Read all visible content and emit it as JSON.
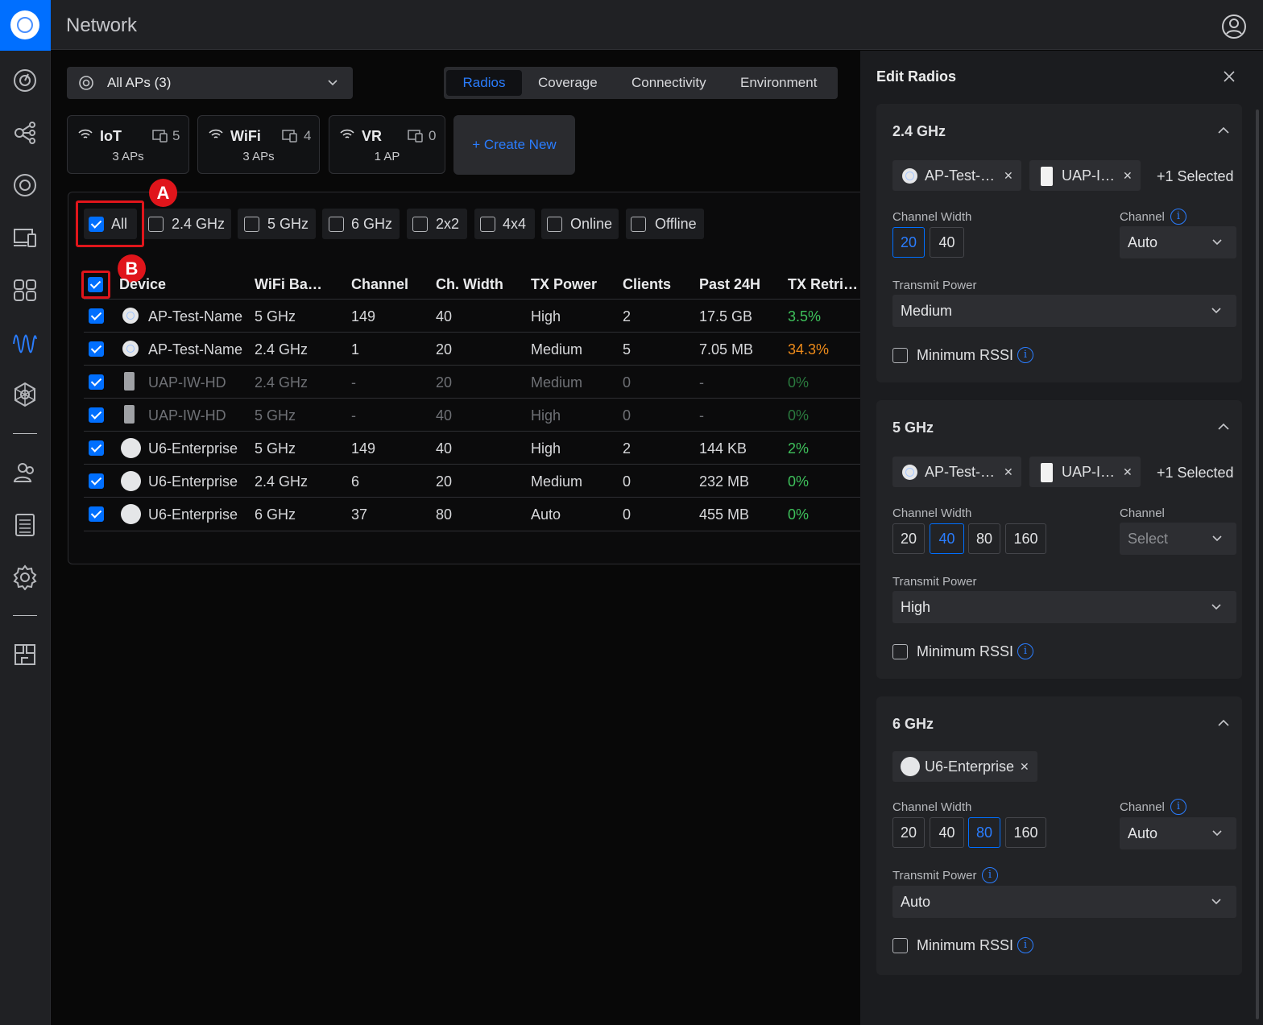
{
  "app": {
    "title": "Network"
  },
  "sidebar": {
    "items": [
      "dashboard",
      "topology",
      "devices",
      "clients-devices",
      "ports",
      "wifi-radios",
      "network-mesh",
      "users",
      "logs",
      "settings",
      "innerspace"
    ]
  },
  "toolbar": {
    "ap_select": "All APs (3)",
    "tabs": [
      {
        "label": "Radios",
        "active": true
      },
      {
        "label": "Coverage"
      },
      {
        "label": "Connectivity"
      },
      {
        "label": "Environment"
      }
    ]
  },
  "groups": [
    {
      "name": "IoT",
      "count": "5",
      "sub": "3 APs"
    },
    {
      "name": "WiFi",
      "count": "4",
      "sub": "3 APs"
    },
    {
      "name": "VR",
      "count": "0",
      "sub": "1 AP"
    }
  ],
  "create_new": "+ Create New",
  "filters": [
    {
      "label": "All",
      "checked": true
    },
    {
      "label": "2.4 GHz",
      "checked": false
    },
    {
      "label": "5 GHz",
      "checked": false
    },
    {
      "label": "6 GHz",
      "checked": false
    },
    {
      "label": "2x2",
      "checked": false
    },
    {
      "label": "4x4",
      "checked": false
    },
    {
      "label": "Online",
      "checked": false
    },
    {
      "label": "Offline",
      "checked": false
    }
  ],
  "annotations": {
    "a": "A",
    "b": "B"
  },
  "table": {
    "headers": [
      "Device",
      "WiFi Ba…",
      "Channel",
      "Ch. Width",
      "TX Power",
      "Clients",
      "Past 24H",
      "TX Retri…"
    ],
    "rows": [
      {
        "icon": "ring",
        "device": "AP-Test-Name",
        "band": "5 GHz",
        "channel": "149",
        "width": "40",
        "tx": "High",
        "clients": "2",
        "past": "17.5 GB",
        "retry": "3.5%",
        "retry_color": "green",
        "dim": false
      },
      {
        "icon": "ring",
        "device": "AP-Test-Name",
        "band": "2.4 GHz",
        "channel": "1",
        "width": "20",
        "tx": "Medium",
        "clients": "5",
        "past": "7.05 MB",
        "retry": "34.3%",
        "retry_color": "orange",
        "dim": false
      },
      {
        "icon": "box",
        "device": "UAP-IW-HD",
        "band": "2.4 GHz",
        "channel": "-",
        "width": "20",
        "tx": "Medium",
        "clients": "0",
        "past": "-",
        "retry": "0%",
        "retry_color": "green",
        "dim": true
      },
      {
        "icon": "box",
        "device": "UAP-IW-HD",
        "band": "5 GHz",
        "channel": "-",
        "width": "40",
        "tx": "High",
        "clients": "0",
        "past": "-",
        "retry": "0%",
        "retry_color": "green",
        "dim": true
      },
      {
        "icon": "disc",
        "device": "U6-Enterprise",
        "band": "5 GHz",
        "channel": "149",
        "width": "40",
        "tx": "High",
        "clients": "2",
        "past": "144 KB",
        "retry": "2%",
        "retry_color": "green",
        "dim": false
      },
      {
        "icon": "disc",
        "device": "U6-Enterprise",
        "band": "2.4 GHz",
        "channel": "6",
        "width": "20",
        "tx": "Medium",
        "clients": "0",
        "past": "232 MB",
        "retry": "0%",
        "retry_color": "green",
        "dim": false
      },
      {
        "icon": "disc",
        "device": "U6-Enterprise",
        "band": "6 GHz",
        "channel": "37",
        "width": "80",
        "tx": "Auto",
        "clients": "0",
        "past": "455 MB",
        "retry": "0%",
        "retry_color": "green",
        "dim": false
      }
    ]
  },
  "edit": {
    "title": "Edit Radios",
    "s24": {
      "title": "2.4 GHz",
      "tag1": "AP-Test-…",
      "tag2": "UAP-I…",
      "more": "+1 Selected",
      "cw_label": "Channel Width",
      "cw": [
        "20",
        "40"
      ],
      "cw_selected": "20",
      "ch_label": "Channel",
      "ch": "Auto",
      "tp_label": "Transmit Power",
      "tp": "Medium",
      "rssi": "Minimum RSSI"
    },
    "s5": {
      "title": "5 GHz",
      "tag1": "AP-Test-…",
      "tag2": "UAP-I…",
      "more": "+1 Selected",
      "cw_label": "Channel Width",
      "cw": [
        "20",
        "40",
        "80",
        "160"
      ],
      "cw_selected": "40",
      "ch_label": "Channel",
      "ch": "Select",
      "tp_label": "Transmit Power",
      "tp": "High",
      "rssi": "Minimum RSSI"
    },
    "s6": {
      "title": "6 GHz",
      "tag1": "U6-Enterprise",
      "cw_label": "Channel Width",
      "cw": [
        "20",
        "40",
        "80",
        "160"
      ],
      "cw_selected": "80",
      "ch_label": "Channel",
      "ch": "Auto",
      "tp_label": "Transmit Power",
      "tp": "Auto",
      "rssi": "Minimum RSSI"
    },
    "info": "i"
  },
  "colors": {
    "accent": "#006fff",
    "green": "#3ec05b",
    "orange": "#ee8b1a",
    "annotation": "#e0151b"
  }
}
